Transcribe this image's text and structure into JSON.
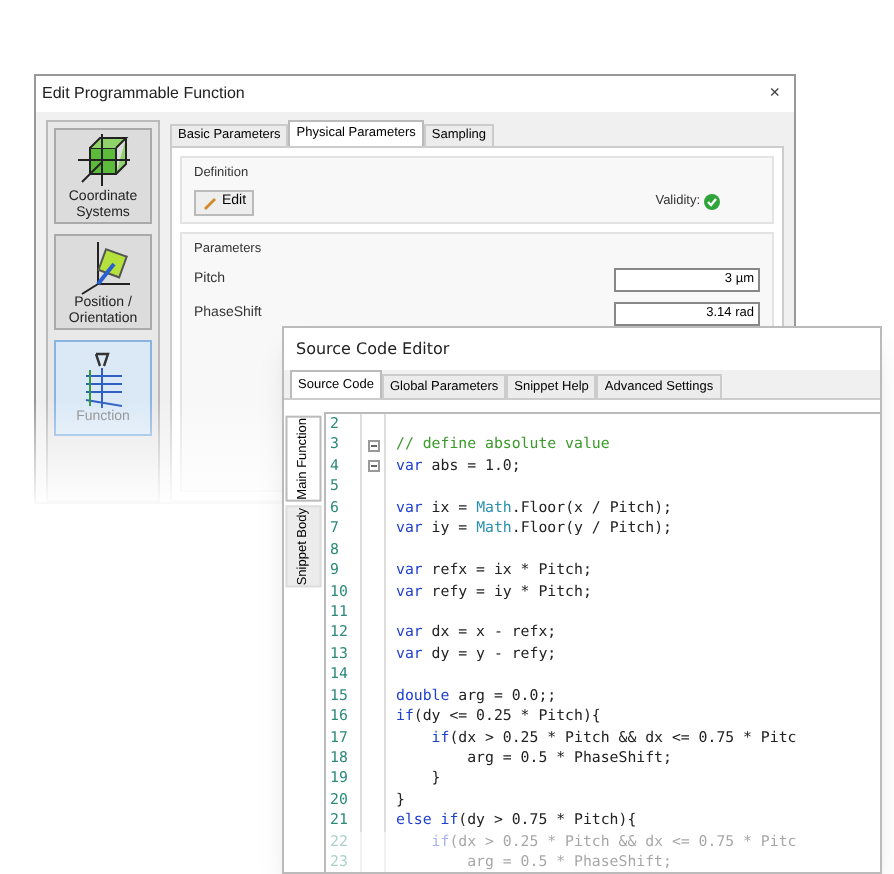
{
  "dialog": {
    "title": "Edit Programmable Function",
    "close": "×",
    "sidebar": [
      {
        "label": "Coordinate Systems",
        "selected": false
      },
      {
        "label": "Position / Orientation",
        "selected": false
      },
      {
        "label": "Function",
        "selected": true
      }
    ],
    "tabs": [
      {
        "label": "Basic Parameters",
        "selected": false
      },
      {
        "label": "Physical Parameters",
        "selected": true
      },
      {
        "label": "Sampling",
        "selected": false
      }
    ],
    "definition": {
      "title": "Definition",
      "edit_button": "Edit",
      "validity_label": "Validity:",
      "valid": true
    },
    "parameters": {
      "title": "Parameters",
      "rows": [
        {
          "name": "Pitch",
          "value": "3 µm"
        },
        {
          "name": "PhaseShift",
          "value": "3.14 rad"
        }
      ]
    }
  },
  "editor": {
    "title": "Source Code Editor",
    "tabs": [
      {
        "label": "Source Code",
        "selected": true
      },
      {
        "label": "Global Parameters",
        "selected": false
      },
      {
        "label": "Snippet Help",
        "selected": false
      },
      {
        "label": "Advanced Settings",
        "selected": false
      }
    ],
    "side_tabs": [
      {
        "label": "Main Function",
        "selected": true
      },
      {
        "label": "Snippet Body",
        "selected": false
      }
    ],
    "lines": [
      {
        "number": "2",
        "fold": false
      },
      {
        "number": "3",
        "fold": true,
        "tokens": [
          {
            "kind": "comment",
            "text": "// define absolute value"
          }
        ]
      },
      {
        "number": "4",
        "fold": true,
        "tokens": [
          {
            "kind": "keyword",
            "text": "var"
          },
          {
            "kind": "plain",
            "text": " abs = 1.0;"
          }
        ]
      },
      {
        "number": "5",
        "fold": false
      },
      {
        "number": "6",
        "fold": false,
        "tokens": [
          {
            "kind": "keyword",
            "text": "var"
          },
          {
            "kind": "plain",
            "text": " ix = "
          },
          {
            "kind": "type",
            "text": "Math"
          },
          {
            "kind": "plain",
            "text": ".Floor(x / Pitch);"
          }
        ]
      },
      {
        "number": "7",
        "fold": false,
        "tokens": [
          {
            "kind": "keyword",
            "text": "var"
          },
          {
            "kind": "plain",
            "text": " iy = "
          },
          {
            "kind": "type",
            "text": "Math"
          },
          {
            "kind": "plain",
            "text": ".Floor(y / Pitch);"
          }
        ]
      },
      {
        "number": "8",
        "fold": false
      },
      {
        "number": "9",
        "fold": false,
        "tokens": [
          {
            "kind": "keyword",
            "text": "var"
          },
          {
            "kind": "plain",
            "text": " refx = ix * Pitch;"
          }
        ]
      },
      {
        "number": "10",
        "fold": false,
        "tokens": [
          {
            "kind": "keyword",
            "text": "var"
          },
          {
            "kind": "plain",
            "text": " refy = iy * Pitch;"
          }
        ]
      },
      {
        "number": "11",
        "fold": false
      },
      {
        "number": "12",
        "fold": false,
        "tokens": [
          {
            "kind": "keyword",
            "text": "var"
          },
          {
            "kind": "plain",
            "text": " dx = x - refx;"
          }
        ]
      },
      {
        "number": "13",
        "fold": false,
        "tokens": [
          {
            "kind": "keyword",
            "text": "var"
          },
          {
            "kind": "plain",
            "text": " dy = y - refy;"
          }
        ]
      },
      {
        "number": "14",
        "fold": false
      },
      {
        "number": "15",
        "fold": false,
        "tokens": [
          {
            "kind": "keyword",
            "text": "double"
          },
          {
            "kind": "plain",
            "text": " arg = 0.0;;"
          }
        ]
      },
      {
        "number": "16",
        "fold": false,
        "tokens": [
          {
            "kind": "keyword",
            "text": "if"
          },
          {
            "kind": "plain",
            "text": "(dy <= 0.25 * Pitch){"
          }
        ]
      },
      {
        "number": "17",
        "fold": false,
        "tokens": [
          {
            "kind": "keyword",
            "text": "    if"
          },
          {
            "kind": "plain",
            "text": "(dx > 0.25 * Pitch && dx <= 0.75 * Pitc"
          }
        ]
      },
      {
        "number": "18",
        "fold": false,
        "tokens": [
          {
            "kind": "plain",
            "text": "        arg = 0.5 * PhaseShift;"
          }
        ]
      },
      {
        "number": "19",
        "fold": false,
        "tokens": [
          {
            "kind": "plain",
            "text": "    }"
          }
        ]
      },
      {
        "number": "20",
        "fold": false,
        "tokens": [
          {
            "kind": "plain",
            "text": "}"
          }
        ]
      },
      {
        "number": "21",
        "fold": false,
        "tokens": [
          {
            "kind": "keyword",
            "text": "else if"
          },
          {
            "kind": "plain",
            "text": "(dy > 0.75 * Pitch){"
          }
        ]
      },
      {
        "number": "22",
        "fold": false,
        "tokens": [
          {
            "kind": "keyword",
            "text": "    if"
          },
          {
            "kind": "plain",
            "text": "(dx > 0.25 * Pitch && dx <= 0.75 * Pitc"
          }
        ]
      },
      {
        "number": "23",
        "fold": false,
        "tokens": [
          {
            "kind": "plain",
            "text": "        arg = 0.5 * PhaseShift;"
          }
        ]
      }
    ]
  }
}
